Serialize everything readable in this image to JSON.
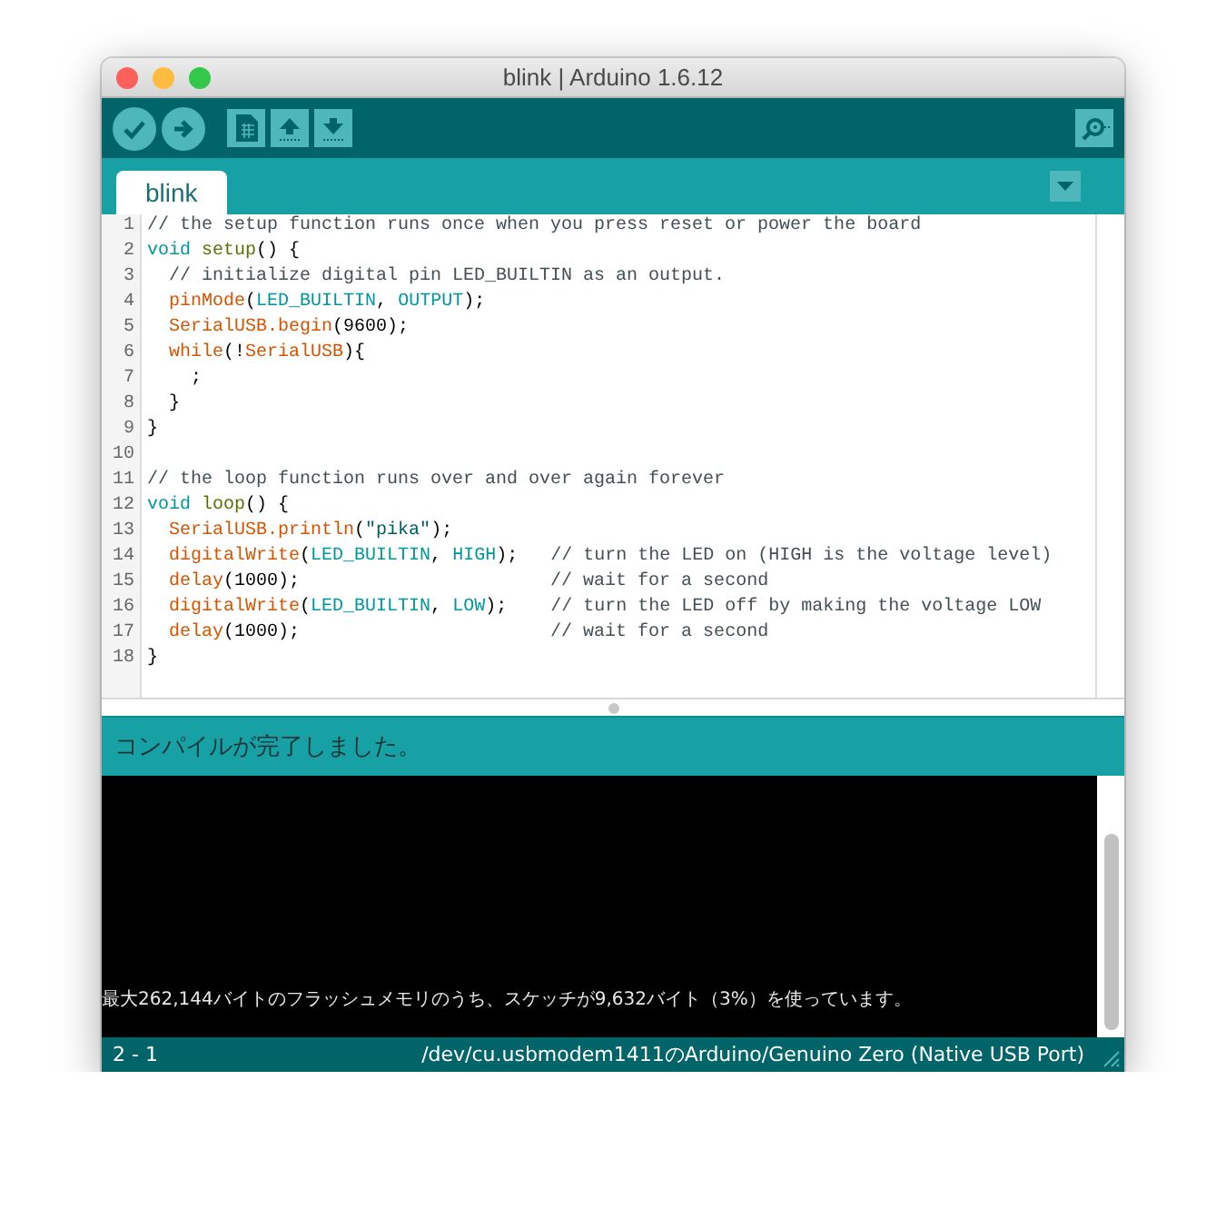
{
  "window": {
    "title": "blink | Arduino 1.6.12"
  },
  "tabs": [
    {
      "label": "blink",
      "selected": true
    }
  ],
  "editor": {
    "lines": [
      {
        "number": "1",
        "tokens": [
          {
            "kind": "comment",
            "text": "// the setup function runs once when you press reset or power the board"
          }
        ]
      },
      {
        "number": "2",
        "tokens": [
          {
            "kind": "keyword",
            "text": "void"
          },
          {
            "kind": "function",
            "text": " setup"
          },
          {
            "kind": "plain",
            "text": "() {"
          }
        ]
      },
      {
        "number": "3",
        "tokens": [
          {
            "kind": "comment",
            "text": "  // initialize digital pin LED_BUILTIN as an output."
          }
        ]
      },
      {
        "number": "4",
        "tokens": [
          {
            "kind": "builtin",
            "text": "  pinMode"
          },
          {
            "kind": "plain",
            "text": "("
          },
          {
            "kind": "constant",
            "text": "LED_BUILTIN"
          },
          {
            "kind": "plain",
            "text": ", "
          },
          {
            "kind": "constant",
            "text": "OUTPUT"
          },
          {
            "kind": "plain",
            "text": ");"
          }
        ]
      },
      {
        "number": "5",
        "tokens": [
          {
            "kind": "builtin",
            "text": "  SerialUSB.begin"
          },
          {
            "kind": "plain",
            "text": "(9600);"
          }
        ]
      },
      {
        "number": "6",
        "tokens": [
          {
            "kind": "builtin",
            "text": "  while"
          },
          {
            "kind": "plain",
            "text": "(!"
          },
          {
            "kind": "builtin",
            "text": "SerialUSB"
          },
          {
            "kind": "plain",
            "text": "){"
          }
        ]
      },
      {
        "number": "7",
        "tokens": [
          {
            "kind": "plain",
            "text": "    ;"
          }
        ]
      },
      {
        "number": "8",
        "tokens": [
          {
            "kind": "plain",
            "text": "  }"
          }
        ]
      },
      {
        "number": "9",
        "tokens": [
          {
            "kind": "plain",
            "text": "}"
          }
        ]
      },
      {
        "number": "10"
      },
      {
        "number": "11",
        "tokens": [
          {
            "kind": "comment",
            "text": "// the loop function runs over and over again forever"
          }
        ]
      },
      {
        "number": "12",
        "tokens": [
          {
            "kind": "keyword",
            "text": "void"
          },
          {
            "kind": "function",
            "text": " loop"
          },
          {
            "kind": "plain",
            "text": "() {"
          }
        ]
      },
      {
        "number": "13",
        "tokens": [
          {
            "kind": "builtin",
            "text": "  SerialUSB.println"
          },
          {
            "kind": "plain",
            "text": "("
          },
          {
            "kind": "string",
            "text": "\"pika\""
          },
          {
            "kind": "plain",
            "text": ");"
          }
        ]
      },
      {
        "number": "14",
        "tokens": [
          {
            "kind": "builtin",
            "text": "  digitalWrite"
          },
          {
            "kind": "plain",
            "text": "("
          },
          {
            "kind": "constant",
            "text": "LED_BUILTIN"
          },
          {
            "kind": "plain",
            "text": ", "
          },
          {
            "kind": "constant",
            "text": "HIGH"
          },
          {
            "kind": "plain",
            "text": ");   "
          },
          {
            "kind": "comment",
            "text": "// turn the LED on (HIGH is the voltage level)"
          }
        ]
      },
      {
        "number": "15",
        "tokens": [
          {
            "kind": "builtin",
            "text": "  delay"
          },
          {
            "kind": "plain",
            "text": "(1000);                       "
          },
          {
            "kind": "comment",
            "text": "// wait for a second"
          }
        ]
      },
      {
        "number": "16",
        "tokens": [
          {
            "kind": "builtin",
            "text": "  digitalWrite"
          },
          {
            "kind": "plain",
            "text": "("
          },
          {
            "kind": "constant",
            "text": "LED_BUILTIN"
          },
          {
            "kind": "plain",
            "text": ", "
          },
          {
            "kind": "constant",
            "text": "LOW"
          },
          {
            "kind": "plain",
            "text": ");    "
          },
          {
            "kind": "comment",
            "text": "// turn the LED off by making the voltage LOW"
          }
        ]
      },
      {
        "number": "17",
        "tokens": [
          {
            "kind": "builtin",
            "text": "  delay"
          },
          {
            "kind": "plain",
            "text": "(1000);                       "
          },
          {
            "kind": "comment",
            "text": "// wait for a second"
          }
        ]
      },
      {
        "number": "18",
        "tokens": [
          {
            "kind": "plain",
            "text": "}"
          }
        ]
      }
    ]
  },
  "message": "コンパイルが完了しました。",
  "console": {
    "lines": [
      "最大262,144バイトのフラッシュメモリのうち、スケッチが9,632バイト（3%）を使っています。"
    ]
  },
  "status_bar": {
    "position": "2 - 1",
    "board": "/dev/cu.usbmodem1411のArduino/Genuino Zero (Native USB Port)"
  }
}
